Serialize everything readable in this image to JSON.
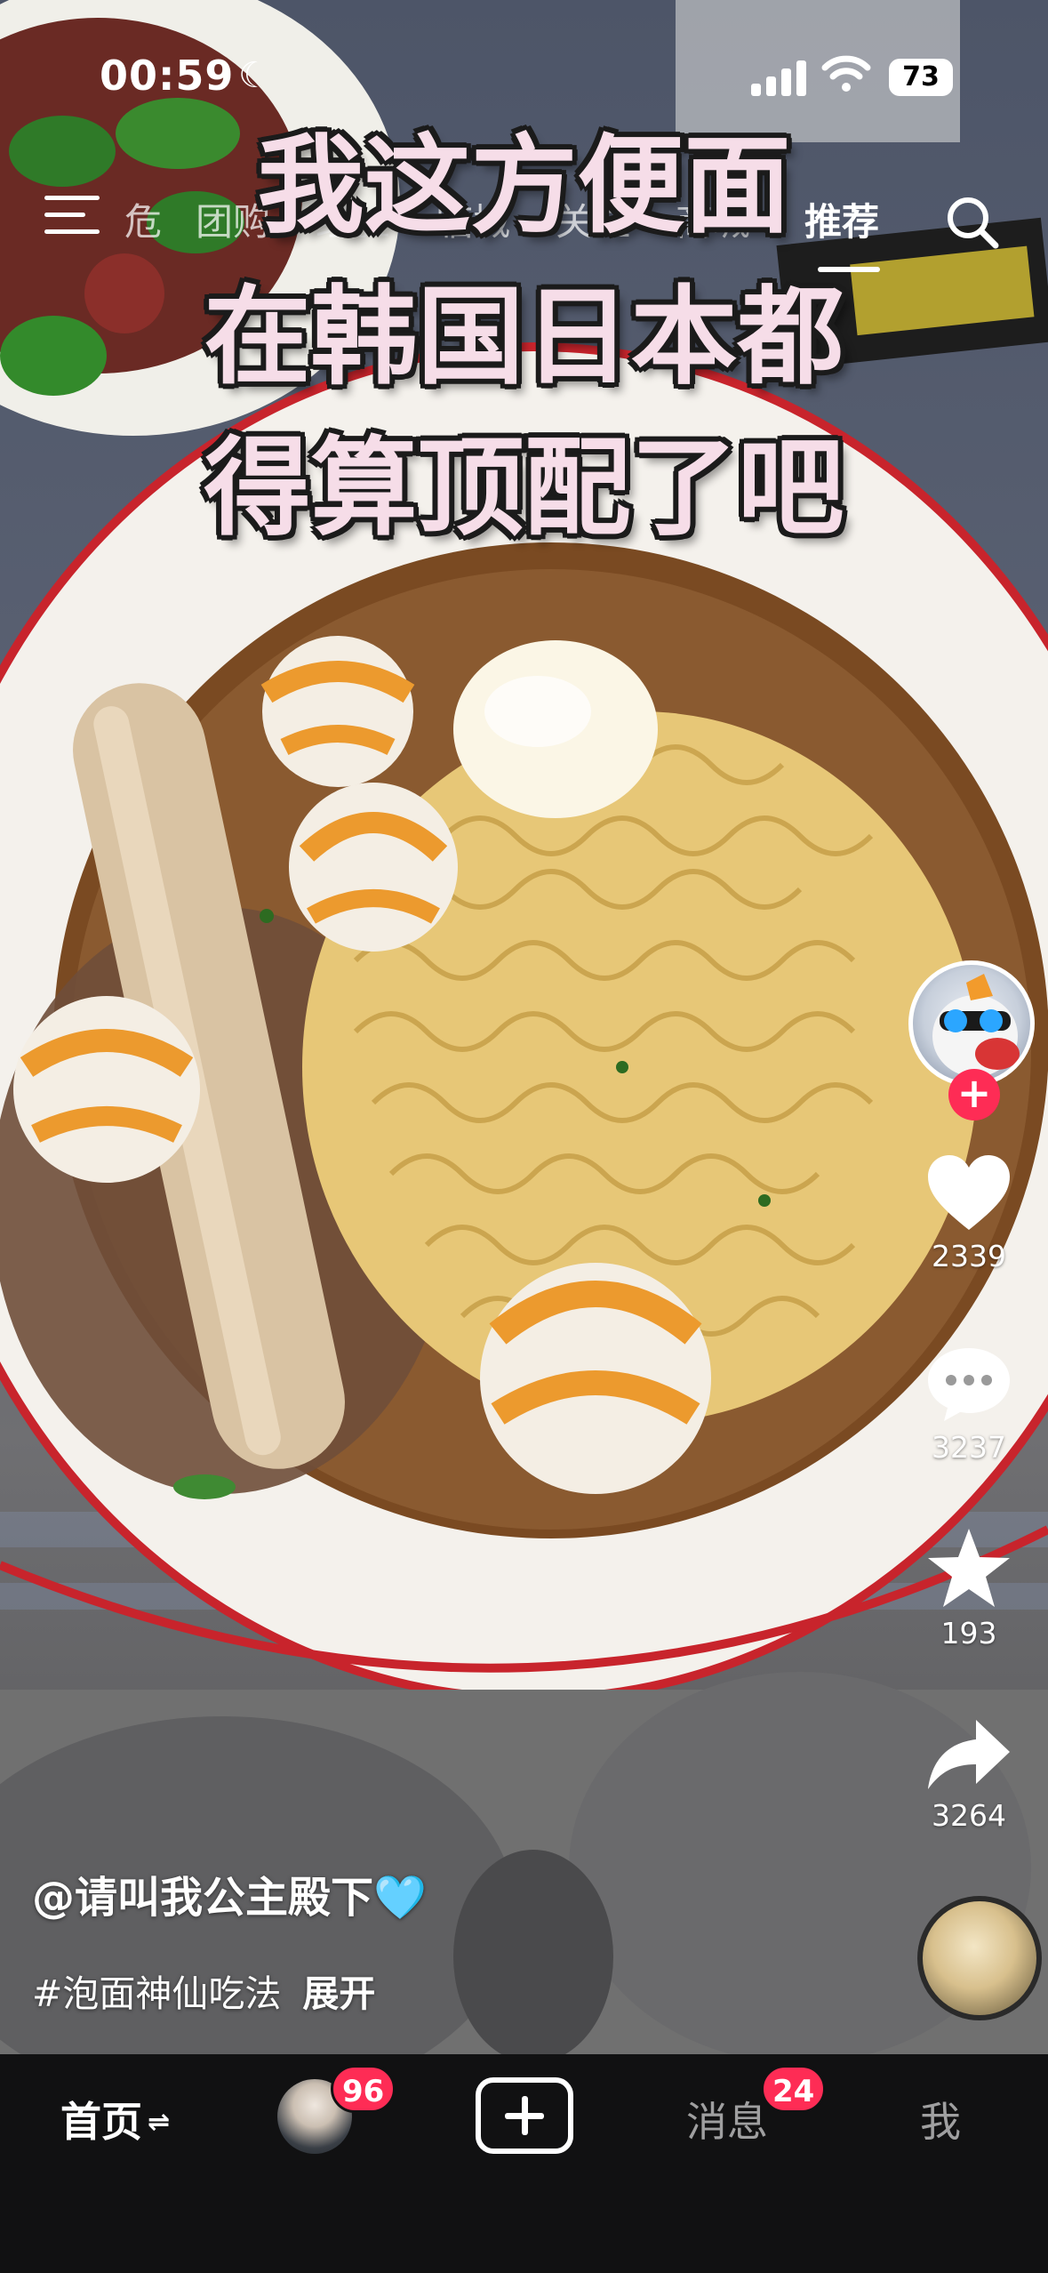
{
  "status_bar": {
    "time": "00:59",
    "battery": "73"
  },
  "top_nav": {
    "tabs": [
      "危",
      "团购",
      "经验",
      "临城",
      "关注",
      "商城",
      "推荐"
    ],
    "active_tab": "推荐"
  },
  "overlay_text": [
    "我这方便面",
    "在韩国日本都",
    "得算顶配了吧"
  ],
  "actions": {
    "likes": "2339",
    "comments": "3237",
    "favorites": "193",
    "shares": "3264"
  },
  "caption": {
    "author": "@请叫我公主殿下",
    "author_emoji": "🩵",
    "hashtag": "#泡面神仙吃法",
    "expand": "展开"
  },
  "bottom_bar": {
    "home": "首页",
    "friends_badge": "96",
    "messages": "消息",
    "messages_badge": "24",
    "me": "我"
  },
  "icons": [
    "menu-icon",
    "search-icon",
    "heart-icon",
    "comment-icon",
    "star-icon",
    "share-icon",
    "plus-icon",
    "music-disc-icon"
  ],
  "colors": {
    "accent": "#fe2c55",
    "bottom_bar_bg": "#111112",
    "overlay_text": "#f6dde8"
  }
}
